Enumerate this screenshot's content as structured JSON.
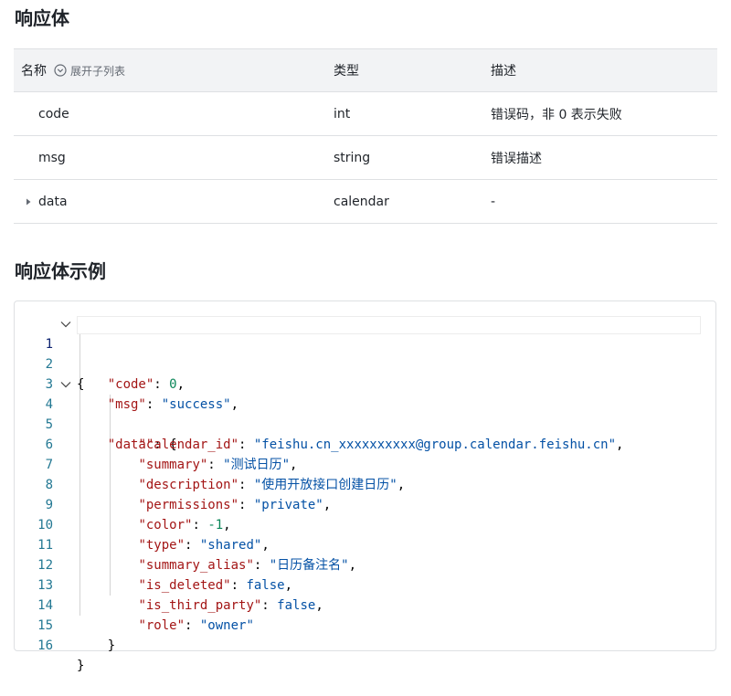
{
  "response_body": {
    "title": "响应体",
    "headers": {
      "name": "名称",
      "expand": "展开子列表",
      "type": "类型",
      "desc": "描述"
    },
    "rows": [
      {
        "name": "code",
        "type": "int",
        "desc": "错误码，非 0 表示失败"
      },
      {
        "name": "msg",
        "type": "string",
        "desc": "错误描述"
      },
      {
        "name": "data",
        "type": "calendar",
        "desc": "-"
      }
    ]
  },
  "example": {
    "title": "响应体示例",
    "line_numbers": [
      "1",
      "2",
      "3",
      "4",
      "5",
      "6",
      "7",
      "8",
      "9",
      "10",
      "11",
      "12",
      "13",
      "14",
      "15",
      "16"
    ],
    "code": {
      "open": "{",
      "close_inner": "}",
      "close_outer": "}",
      "code_key": "\"code\"",
      "code_val": "0",
      "msg_key": "\"msg\"",
      "msg_val": "\"success\"",
      "data_key": "\"data\"",
      "calendar_id_key": "\"calendar_id\"",
      "calendar_id_val": "\"feishu.cn_xxxxxxxxxx@group.calendar.feishu.cn\"",
      "summary_key": "\"summary\"",
      "summary_val": "\"测试日历\"",
      "description_key": "\"description\"",
      "description_val": "\"使用开放接口创建日历\"",
      "permissions_key": "\"permissions\"",
      "permissions_val": "\"private\"",
      "color_key": "\"color\"",
      "color_val": "-1",
      "type_key": "\"type\"",
      "type_val": "\"shared\"",
      "summary_alias_key": "\"summary_alias\"",
      "summary_alias_val": "\"日历备注名\"",
      "is_deleted_key": "\"is_deleted\"",
      "is_deleted_val": "false",
      "is_third_party_key": "\"is_third_party\"",
      "is_third_party_val": "false",
      "role_key": "\"role\"",
      "role_val": "\"owner\""
    }
  },
  "colors": {
    "key": "#a31515",
    "string": "#0451a5",
    "number": "#098658",
    "line_number": "#237893",
    "header_bg": "#f2f3f5",
    "border": "#dee0e3"
  }
}
